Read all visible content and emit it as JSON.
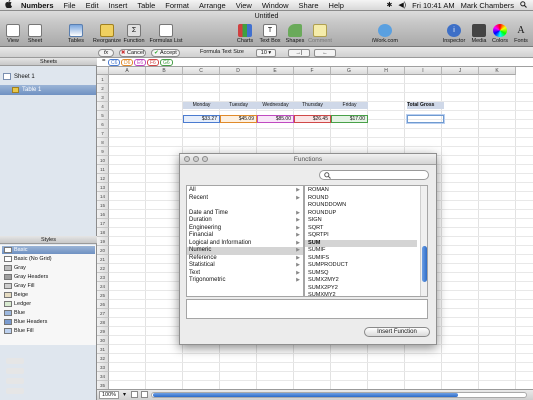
{
  "menubar": {
    "apple": "",
    "items": [
      "Numbers",
      "File",
      "Edit",
      "Insert",
      "Table",
      "Format",
      "Arrange",
      "View",
      "Window",
      "Share",
      "Help"
    ],
    "clock": "Fri 10:41 AM",
    "user": "Mark Chambers"
  },
  "window": {
    "title": "Untitled"
  },
  "toolbar": {
    "view": "View",
    "sheet": "Sheet",
    "tables": "Tables",
    "reorganize": "Reorganize",
    "function": "Function",
    "formulas_list": "Formulas List",
    "charts": "Charts",
    "text_box": "Text Box",
    "shapes": "Shapes",
    "comment": "Comment",
    "iwork": "iWork.com",
    "inspector": "Inspector",
    "media": "Media",
    "colors": "Colors",
    "fonts": "Fonts"
  },
  "formatbar": {
    "fx": "fx",
    "cancel": "Cancel",
    "accept": "Accept",
    "formula_text_size_label": "Formula Text Size",
    "formula_text_size_value": "10"
  },
  "formula": {
    "tokens": [
      {
        "text": "C6",
        "color": "#4a7bd0"
      },
      {
        "text": "D6",
        "color": "#e08a2a"
      },
      {
        "text": "E6",
        "color": "#c04ac0"
      },
      {
        "text": "F6",
        "color": "#d04848"
      },
      {
        "text": "G6",
        "color": "#48a048"
      }
    ]
  },
  "sidebar": {
    "sheets_header": "Sheets",
    "sheet_name": "Sheet 1",
    "table_name": "Table 1",
    "styles_header": "Styles",
    "styles": [
      {
        "name": "Basic",
        "color": "#ffffff"
      },
      {
        "name": "Basic (No Grid)",
        "color": "#ffffff"
      },
      {
        "name": "Gray",
        "color": "#bdbdbd"
      },
      {
        "name": "Gray Headers",
        "color": "#a0a0a0"
      },
      {
        "name": "Gray Fill",
        "color": "#cfcfcf"
      },
      {
        "name": "Beige",
        "color": "#e6dcc2"
      },
      {
        "name": "Ledger",
        "color": "#d8ead0"
      },
      {
        "name": "Blue",
        "color": "#9db8de"
      },
      {
        "name": "Blue Headers",
        "color": "#7b9cd0"
      },
      {
        "name": "Blue Fill",
        "color": "#bcd0ee"
      }
    ]
  },
  "grid": {
    "columns": [
      "A",
      "B",
      "C",
      "D",
      "E",
      "F",
      "G",
      "H",
      "I",
      "J",
      "K"
    ],
    "rows": [
      "1",
      "2",
      "3",
      "4",
      "5",
      "6",
      "7",
      "8",
      "9",
      "10",
      "11",
      "12",
      "13",
      "14",
      "15",
      "16",
      "17",
      "18",
      "19",
      "20",
      "21",
      "22",
      "23",
      "24",
      "25",
      "26",
      "27",
      "28",
      "29",
      "30",
      "31",
      "32",
      "33",
      "34",
      "35",
      "36"
    ],
    "headers": [
      "Monday",
      "Tuesday",
      "Wednesday",
      "Thursday",
      "Friday"
    ],
    "values": [
      {
        "text": "$33.27",
        "color": "#4a7bd0",
        "fill": "#e6eefb"
      },
      {
        "text": "$45.09",
        "color": "#e08a2a",
        "fill": "#fdf0e0"
      },
      {
        "text": "$85.00",
        "color": "#c04ac0",
        "fill": "#f8e6f8"
      },
      {
        "text": "$26.45",
        "color": "#d04848",
        "fill": "#fbe4e4"
      },
      {
        "text": "$17.00",
        "color": "#48a048",
        "fill": "#e4f3e4"
      }
    ],
    "total_label": "Total Gross"
  },
  "bottombar": {
    "zoom": "100%"
  },
  "dialog": {
    "title": "Functions",
    "search_value": "",
    "categories": [
      {
        "label": "All",
        "arrow": "▶"
      },
      {
        "label": "Recent",
        "arrow": "▶"
      },
      {
        "label": "",
        "arrow": ""
      },
      {
        "label": "Date and Time",
        "arrow": "▶"
      },
      {
        "label": "Duration",
        "arrow": "▶"
      },
      {
        "label": "Engineering",
        "arrow": "▶"
      },
      {
        "label": "Financial",
        "arrow": "▶"
      },
      {
        "label": "Logical and Information",
        "arrow": "▶"
      },
      {
        "label": "Numeric",
        "arrow": "▶"
      },
      {
        "label": "Reference",
        "arrow": "▶"
      },
      {
        "label": "Statistical",
        "arrow": "▶"
      },
      {
        "label": "Text",
        "arrow": "▶"
      },
      {
        "label": "Trigonometric",
        "arrow": "▶"
      }
    ],
    "selected_category": "Numeric",
    "functions": [
      "ROMAN",
      "ROUND",
      "ROUNDDOWN",
      "ROUNDUP",
      "SIGN",
      "SQRT",
      "SQRTPI",
      "SUM",
      "SUMIF",
      "SUMIFS",
      "SUMPRODUCT",
      "SUMSQ",
      "SUMX2MY2",
      "SUMX2PY2",
      "SUMXMY2"
    ],
    "selected_function": "SUM",
    "insert_button": "Insert Function"
  }
}
